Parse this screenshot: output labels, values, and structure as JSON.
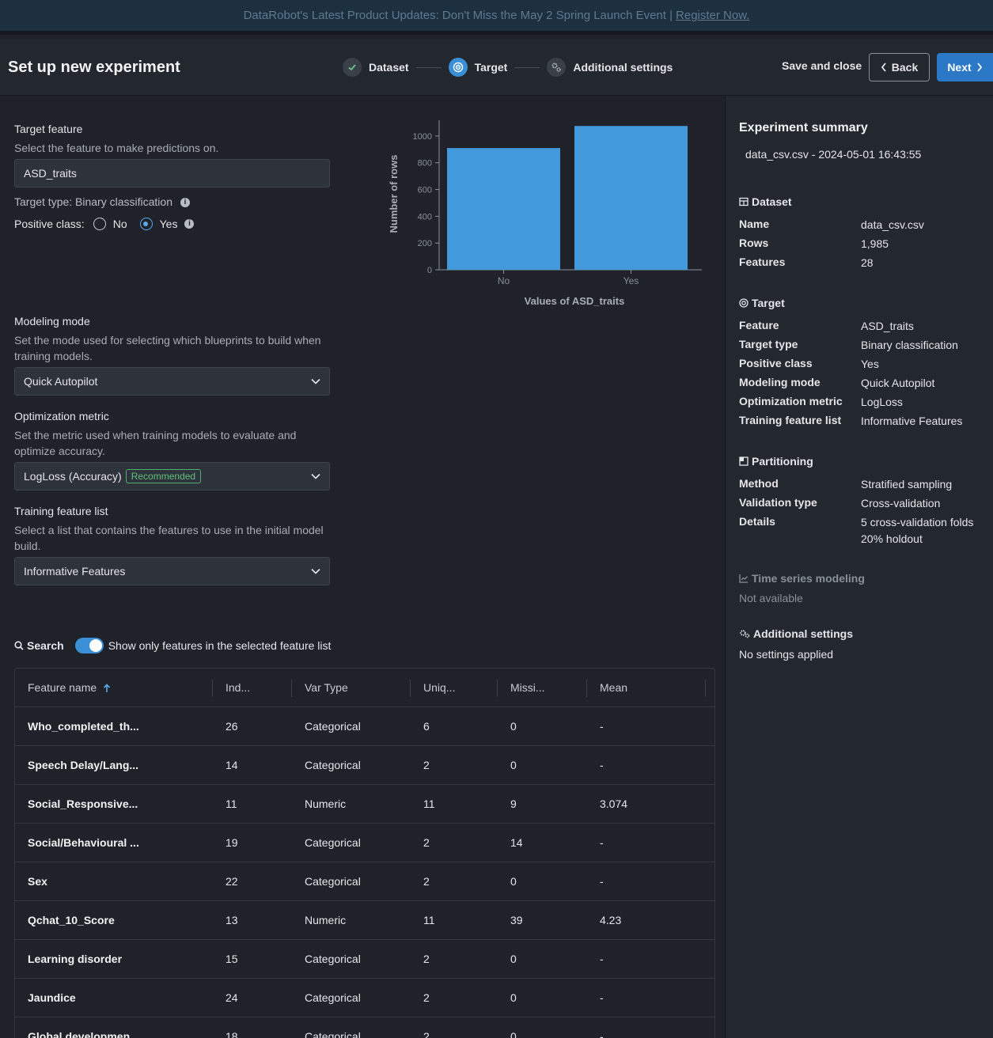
{
  "banner": {
    "text": "DataRobot's Latest Product Updates: Don't Miss the May 2 Spring Launch Event |",
    "link": "Register Now."
  },
  "header": {
    "title": "Set up new experiment",
    "steps": [
      {
        "label": "Dataset"
      },
      {
        "label": "Target"
      },
      {
        "label": "Additional settings"
      }
    ],
    "save_close": "Save and close",
    "back": "Back",
    "next": "Next"
  },
  "target": {
    "label": "Target feature",
    "help": "Select the feature to make predictions on.",
    "value": "ASD_traits",
    "type_text": "Target type: Binary classification",
    "positive_label": "Positive class:",
    "options": [
      "No",
      "Yes"
    ],
    "selected": "Yes"
  },
  "modeling": {
    "label": "Modeling mode",
    "help": "Set the mode used for selecting which blueprints to build when training models.",
    "value": "Quick Autopilot"
  },
  "metric": {
    "label": "Optimization metric",
    "help": "Set the metric used when training models to evaluate and optimize accuracy.",
    "value": "LogLoss (Accuracy)",
    "badge": "Recommended"
  },
  "featurelist": {
    "label": "Training feature list",
    "help": "Select a list that contains the features to use in the initial model build.",
    "value": "Informative Features"
  },
  "search": {
    "label": "Search",
    "toggle_label": "Show only features in the selected feature list"
  },
  "table": {
    "headers": [
      "Feature name",
      "Ind...",
      "Var Type",
      "Uniq...",
      "Missi...",
      "Mean"
    ],
    "rows": [
      [
        "Who_completed_th...",
        "26",
        "Categorical",
        "6",
        "0",
        "-"
      ],
      [
        "Speech Delay/Lang...",
        "14",
        "Categorical",
        "2",
        "0",
        "-"
      ],
      [
        "Social_Responsive...",
        "11",
        "Numeric",
        "11",
        "9",
        "3.074"
      ],
      [
        "Social/Behavioural ...",
        "19",
        "Categorical",
        "2",
        "14",
        "-"
      ],
      [
        "Sex",
        "22",
        "Categorical",
        "2",
        "0",
        "-"
      ],
      [
        "Qchat_10_Score",
        "13",
        "Numeric",
        "11",
        "39",
        "4.23"
      ],
      [
        "Learning disorder",
        "15",
        "Categorical",
        "2",
        "0",
        "-"
      ],
      [
        "Jaundice",
        "24",
        "Categorical",
        "2",
        "0",
        "-"
      ],
      [
        "Global developmen",
        "18",
        "Categorical",
        "2",
        "0",
        "-"
      ]
    ]
  },
  "chart_data": {
    "type": "bar",
    "categories": [
      "No",
      "Yes"
    ],
    "values": [
      910,
      1075
    ],
    "xlabel": "Values of ASD_traits",
    "ylabel": "Number of rows",
    "ylim": [
      0,
      1100
    ],
    "yticks": [
      0,
      200,
      400,
      600,
      800,
      1000
    ],
    "color": "#4299dc"
  },
  "summary": {
    "title": "Experiment summary",
    "subtitle": "data_csv.csv - 2024-05-01 16:43:55",
    "dataset": {
      "heading": "Dataset",
      "items": [
        [
          "Name",
          "data_csv.csv"
        ],
        [
          "Rows",
          "1,985"
        ],
        [
          "Features",
          "28"
        ]
      ]
    },
    "target": {
      "heading": "Target",
      "items": [
        [
          "Feature",
          "ASD_traits"
        ],
        [
          "Target type",
          "Binary classification"
        ],
        [
          "Positive class",
          "Yes"
        ],
        [
          "Modeling mode",
          "Quick Autopilot"
        ],
        [
          "Optimization metric",
          "LogLoss"
        ],
        [
          "Training feature list",
          "Informative Features"
        ]
      ]
    },
    "partitioning": {
      "heading": "Partitioning",
      "items": [
        [
          "Method",
          "Stratified sampling"
        ],
        [
          "Validation type",
          "Cross-validation"
        ],
        [
          "Details",
          "5 cross-validation folds"
        ]
      ],
      "details_line2": "20% holdout"
    },
    "timeseries": {
      "heading": "Time series modeling",
      "text": "Not available"
    },
    "additional": {
      "heading": "Additional settings",
      "text": "No settings applied"
    }
  }
}
